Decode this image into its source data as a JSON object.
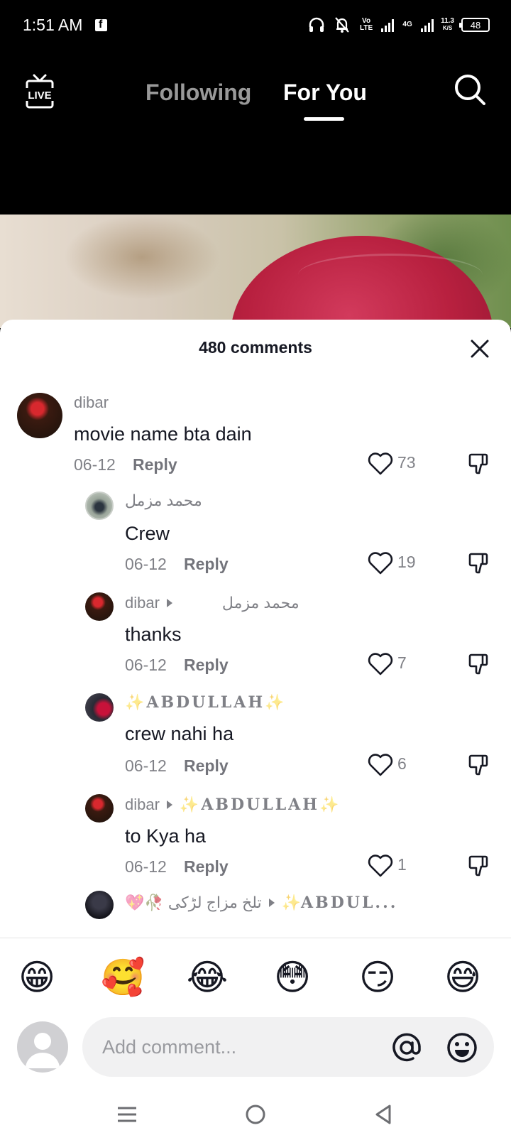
{
  "status_bar": {
    "time": "1:51 AM",
    "volte": "Vo LTE",
    "network": "4G",
    "speed_value": "11.3",
    "speed_unit": "K/S",
    "battery": "48"
  },
  "top_nav": {
    "tabs": [
      {
        "label": "Following",
        "active": false
      },
      {
        "label": "For You",
        "active": true
      }
    ]
  },
  "comments": {
    "title": "480 comments",
    "items": [
      {
        "user": "dibar",
        "reply_to": "",
        "text": "movie name bta dain",
        "date": "06-12",
        "reply_label": "Reply",
        "likes": "73",
        "avatar": "rose-avatar"
      },
      {
        "user": "محمد مزمل",
        "reply_to": "",
        "text": "Crew",
        "date": "06-12",
        "reply_label": "Reply",
        "likes": "19",
        "avatar": "person-avatar"
      },
      {
        "user": "dibar",
        "reply_to": "محمد مزمل",
        "text": "thanks",
        "date": "06-12",
        "reply_label": "Reply",
        "likes": "7",
        "avatar": "rose-avatar"
      },
      {
        "user": "✨ABDULLAH✨",
        "reply_to": "",
        "text": "crew nahi ha",
        "date": "06-12",
        "reply_label": "Reply",
        "likes": "6",
        "avatar": "spider-avatar"
      },
      {
        "user": "dibar",
        "reply_to": "✨ABDULLAH✨",
        "text": "to Kya ha",
        "date": "06-12",
        "reply_label": "Reply",
        "likes": "1",
        "avatar": "rose-avatar"
      },
      {
        "user": "💖🥀 تلخ مزاج لڑکی",
        "reply_to": "✨ABDUL...",
        "text": "",
        "date": "",
        "reply_label": "",
        "likes": "",
        "avatar": "dark-avatar"
      }
    ]
  },
  "emoji_bar": [
    "😁",
    "🥰",
    "😂",
    "😳",
    "😏",
    "😅"
  ],
  "input": {
    "placeholder": "Add comment..."
  },
  "colors": {
    "foreground": "#161823",
    "muted": "#8a8b91",
    "sheet_bg": "#ffffff",
    "input_bg": "#f1f1f2"
  }
}
